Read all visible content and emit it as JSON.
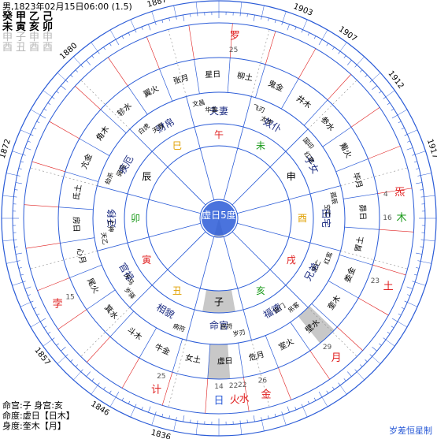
{
  "header": {
    "line1": "男,1823年02月15日06:00 (1.5)",
    "ganzhi_rows": [
      {
        "cells": [
          "癸",
          "甲",
          "乙",
          "己"
        ],
        "faint": false
      },
      {
        "cells": [
          "未",
          "寅",
          "亥",
          "卯"
        ],
        "faint": false
      },
      {
        "cells": [
          "申",
          "子",
          "申",
          "申"
        ],
        "faint": true
      },
      {
        "cells": [
          "酉",
          "丑",
          "酉",
          "酉"
        ],
        "faint": true
      }
    ]
  },
  "footer": {
    "line1": "命宫:子  身宫:亥",
    "line2": "命度:虚日【日木】",
    "line3": "身度:奎木【月】"
  },
  "credit": "岁差恒星制",
  "colors": {
    "ring": "#2a5bd7",
    "red": "#e02020",
    "green": "#1a9a1a",
    "orange": "#e0a000",
    "gray": "#c8c8c8"
  },
  "center_label": "虚日5度",
  "years": [
    "1887",
    "1898",
    "1903",
    "1907",
    "1912",
    "1917",
    "1823",
    "1836",
    "1846",
    "1857",
    "1872",
    "1880"
  ],
  "palaces": [
    "夫妻",
    "奴仆",
    "子女",
    "田宅",
    "兄弟",
    "福德",
    "命宫",
    "相貌",
    "官禄",
    "迁移",
    "疾厄",
    "财帛"
  ],
  "branches": [
    {
      "t": "午",
      "c": "red"
    },
    {
      "t": "未",
      "c": "green"
    },
    {
      "t": "申",
      "c": "ink"
    },
    {
      "t": "酉",
      "c": "orange"
    },
    {
      "t": "戌",
      "c": "red"
    },
    {
      "t": "亥",
      "c": "green"
    },
    {
      "t": "子",
      "c": "ink"
    },
    {
      "t": "丑",
      "c": "orange"
    },
    {
      "t": "寅",
      "c": "red"
    },
    {
      "t": "卯",
      "c": "green"
    },
    {
      "t": "辰",
      "c": "ink"
    },
    {
      "t": "巳",
      "c": "orange"
    }
  ],
  "mansions": [
    "柳土",
    "鬼金",
    "井木",
    "参水",
    "觜火",
    "毕月",
    "昴日",
    "胃土",
    "娄金",
    "奎木",
    "壁水",
    "室火",
    "危月",
    "虚日",
    "女土",
    "牛金",
    "斗木",
    "箕水",
    "尾火",
    "心月",
    "房日",
    "氐土",
    "亢金",
    "角木",
    "轸水",
    "翼火",
    "张月",
    "星日"
  ],
  "planets": [
    {
      "label": "罗",
      "c": "red",
      "deg": "25"
    },
    {
      "label": "炁",
      "c": "red",
      "deg": "4"
    },
    {
      "label": "木",
      "c": "green",
      "deg": "16"
    },
    {
      "label": "土",
      "c": "red",
      "deg": "23"
    },
    {
      "label": "月",
      "c": "red",
      "deg": "29"
    },
    {
      "label": "金",
      "c": "red",
      "deg": "26"
    },
    {
      "label": "水",
      "c": "red",
      "deg": "22"
    },
    {
      "label": "火",
      "c": "red",
      "deg": "22"
    },
    {
      "label": "日",
      "c": "blue",
      "deg": "14"
    },
    {
      "label": "计",
      "c": "red",
      "deg": "25"
    },
    {
      "label": "孛",
      "c": "red",
      "deg": "15"
    }
  ],
  "stars": [
    [
      "飞刃",
      "太岁"
    ],
    [
      "国印",
      "红艳"
    ],
    [
      "孤辰",
      "空亡"
    ],
    [
      "红鸾",
      "空亡"
    ],
    [
      "吊客",
      "丧门"
    ],
    [
      "岁刃",
      "官符"
    ],
    [
      "病符"
    ],
    [
      "岁驿",
      "天马"
    ],
    [
      "天乙",
      "亡神"
    ],
    [
      "劫杀",
      "驿马"
    ],
    [
      "白虎",
      "天喜"
    ],
    [
      "文昌",
      "华盖"
    ]
  ]
}
